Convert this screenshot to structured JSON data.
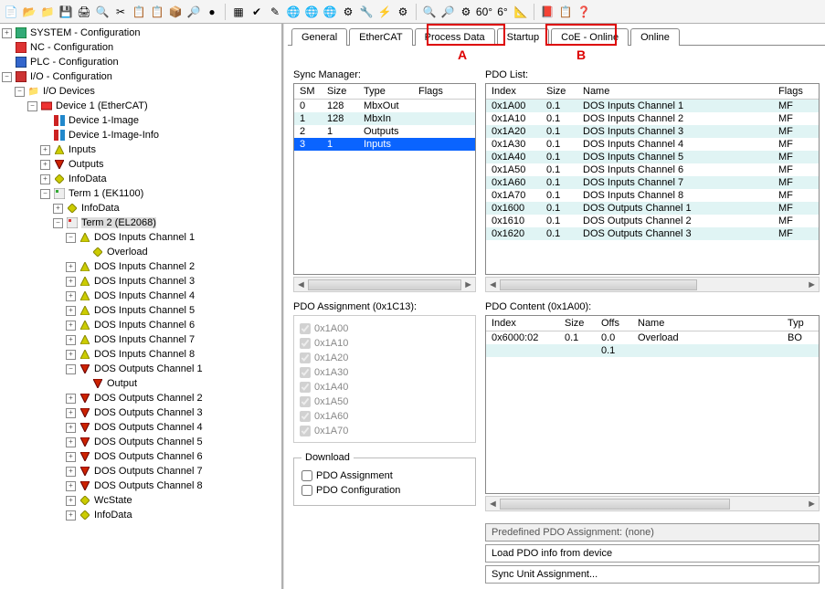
{
  "toolbar_icons": [
    "📄",
    "📂",
    "📁",
    "💾",
    "🖨",
    "🔍",
    "✂",
    "📋",
    "📋",
    "📦",
    "🔎",
    "●",
    "|",
    "▦",
    "✔",
    "✎",
    "🌐",
    "🌐",
    "🌐",
    "⚙",
    "🔧",
    "⚡",
    "⚙",
    "|",
    "🔍",
    "🔎",
    "⚙",
    "60°",
    "6°",
    "📐",
    "|",
    "📕",
    "📋",
    "❓"
  ],
  "tree": {
    "system": "SYSTEM - Configuration",
    "nc": "NC - Configuration",
    "plc": "PLC - Configuration",
    "io": "I/O - Configuration",
    "io_devices": "I/O Devices",
    "device1": "Device 1 (EtherCAT)",
    "dev1_image": "Device 1-Image",
    "dev1_image_info": "Device 1-Image-Info",
    "inputs": "Inputs",
    "outputs": "Outputs",
    "infodata": "InfoData",
    "term1": "Term 1 (EK1100)",
    "term2": "Term 2 (EL2068)",
    "dos_in": [
      "DOS Inputs Channel 1",
      "DOS Inputs Channel 2",
      "DOS Inputs Channel 3",
      "DOS Inputs Channel 4",
      "DOS Inputs Channel 5",
      "DOS Inputs Channel 6",
      "DOS Inputs Channel 7",
      "DOS Inputs Channel 8"
    ],
    "overload": "Overload",
    "dos_out": [
      "DOS Outputs Channel 1",
      "DOS Outputs Channel 2",
      "DOS Outputs Channel 3",
      "DOS Outputs Channel 4",
      "DOS Outputs Channel 5",
      "DOS Outputs Channel 6",
      "DOS Outputs Channel 7",
      "DOS Outputs Channel 8"
    ],
    "output": "Output",
    "wcstate": "WcState"
  },
  "tabs": [
    "General",
    "EtherCAT",
    "Process Data",
    "Startup",
    "CoE - Online",
    "Online"
  ],
  "callouts": {
    "a": "A",
    "b": "B"
  },
  "syncmgr": {
    "label": "Sync Manager:",
    "headers": [
      "SM",
      "Size",
      "Type",
      "Flags"
    ],
    "rows": [
      {
        "c": [
          "0",
          "128",
          "MbxOut",
          ""
        ],
        "sel": false,
        "stripe": false
      },
      {
        "c": [
          "1",
          "128",
          "MbxIn",
          ""
        ],
        "sel": false,
        "stripe": true
      },
      {
        "c": [
          "2",
          "1",
          "Outputs",
          ""
        ],
        "sel": false,
        "stripe": false
      },
      {
        "c": [
          "3",
          "1",
          "Inputs",
          ""
        ],
        "sel": true,
        "stripe": false
      }
    ]
  },
  "pdolist": {
    "label": "PDO List:",
    "headers": [
      "Index",
      "Size",
      "Name",
      "Flags"
    ],
    "rows": [
      {
        "c": [
          "0x1A00",
          "0.1",
          "DOS Inputs Channel 1",
          "MF"
        ],
        "stripe": true
      },
      {
        "c": [
          "0x1A10",
          "0.1",
          "DOS Inputs Channel 2",
          "MF"
        ],
        "stripe": false
      },
      {
        "c": [
          "0x1A20",
          "0.1",
          "DOS Inputs Channel 3",
          "MF"
        ],
        "stripe": true
      },
      {
        "c": [
          "0x1A30",
          "0.1",
          "DOS Inputs Channel 4",
          "MF"
        ],
        "stripe": false
      },
      {
        "c": [
          "0x1A40",
          "0.1",
          "DOS Inputs Channel 5",
          "MF"
        ],
        "stripe": true
      },
      {
        "c": [
          "0x1A50",
          "0.1",
          "DOS Inputs Channel 6",
          "MF"
        ],
        "stripe": false
      },
      {
        "c": [
          "0x1A60",
          "0.1",
          "DOS Inputs Channel 7",
          "MF"
        ],
        "stripe": true
      },
      {
        "c": [
          "0x1A70",
          "0.1",
          "DOS Inputs Channel 8",
          "MF"
        ],
        "stripe": false
      },
      {
        "c": [
          "0x1600",
          "0.1",
          "DOS Outputs Channel 1",
          "MF"
        ],
        "stripe": true
      },
      {
        "c": [
          "0x1610",
          "0.1",
          "DOS Outputs Channel 2",
          "MF"
        ],
        "stripe": false
      },
      {
        "c": [
          "0x1620",
          "0.1",
          "DOS Outputs Channel 3",
          "MF"
        ],
        "stripe": true
      }
    ]
  },
  "pdoassign": {
    "label": "PDO Assignment (0x1C13):",
    "items": [
      "0x1A00",
      "0x1A10",
      "0x1A20",
      "0x1A30",
      "0x1A40",
      "0x1A50",
      "0x1A60",
      "0x1A70"
    ]
  },
  "pdocontent": {
    "label": "PDO Content (0x1A00):",
    "headers": [
      "Index",
      "Size",
      "Offs",
      "Name",
      "Typ"
    ],
    "rows": [
      {
        "c": [
          "0x6000:02",
          "0.1",
          "0.0",
          "Overload",
          "BO"
        ],
        "stripe": false
      },
      {
        "c": [
          "",
          "",
          "0.1",
          "",
          ""
        ],
        "stripe": true
      }
    ]
  },
  "download": {
    "legend": "Download",
    "opt1": "PDO Assignment",
    "opt2": "PDO Configuration"
  },
  "bottom": {
    "predef": "Predefined PDO Assignment: (none)",
    "load": "Load PDO info from device",
    "sync": "Sync Unit Assignment..."
  }
}
